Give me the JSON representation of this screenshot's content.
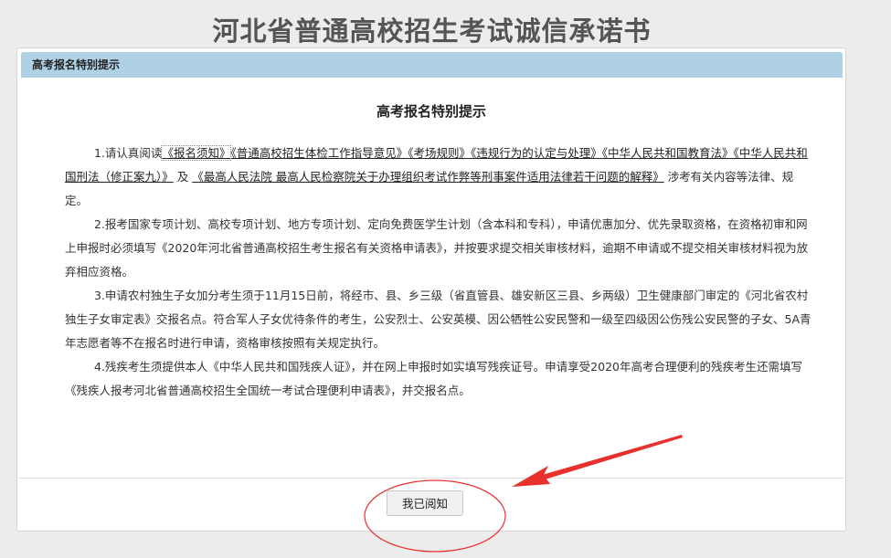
{
  "page": {
    "title": "河北省普通高校招生考试诚信承诺书"
  },
  "modal": {
    "header_title": "高考报名特别提示",
    "heading": "高考报名特别提示",
    "paragraphs": {
      "p1": {
        "prefix": "1.请认真阅读",
        "links": [
          "《报名须知》",
          "《普通高校招生体检工作指导意见》",
          "《考场规则》",
          "《违规行为的认定与处理》",
          "《中华人民共和国教育法》",
          "《中华人民共和国刑法（修正案九）》"
        ],
        "and": " 及 ",
        "link_last": "《最高人民法院 最高人民检察院关于办理组织考试作弊等刑事案件适用法律若干问题的解释》",
        "suffix": " 涉考有关内容等法律、规定。"
      },
      "p2": "2.报考国家专项计划、高校专项计划、地方专项计划、定向免费医学生计划（含本科和专科），申请优惠加分、优先录取资格，在资格初审和网上申报时必须填写《2020年河北省普通高校招生考生报名有关资格申请表》，并按要求提交相关审核材料，逾期不申请或不提交相关审核材料视为放弃相应资格。",
      "p3": "3.申请农村独生子女加分考生须于11月15日前，将经市、县、乡三级（省直管县、雄安新区三县、乡两级）卫生健康部门审定的《河北省农村独生子女审定表》交报名点。符合军人子女优待条件的考生，公安烈士、公安英模、因公牺牲公安民警和一级至四级因公伤残公安民警的子女、5A青年志愿者等不在报名时进行申请，资格审核按照有关规定执行。",
      "p4": "4.残疾考生须提供本人《中华人民共和国残疾人证》，并在网上申报时如实填写残疾证号。申请享受2020年高考合理便利的残疾考生还需填写《残疾人报考河北省普通高校招生全国统一考试合理便利申请表》，并交报名点。"
    },
    "ack_button": "我已阅知"
  },
  "annotation_color": "#e8302c"
}
